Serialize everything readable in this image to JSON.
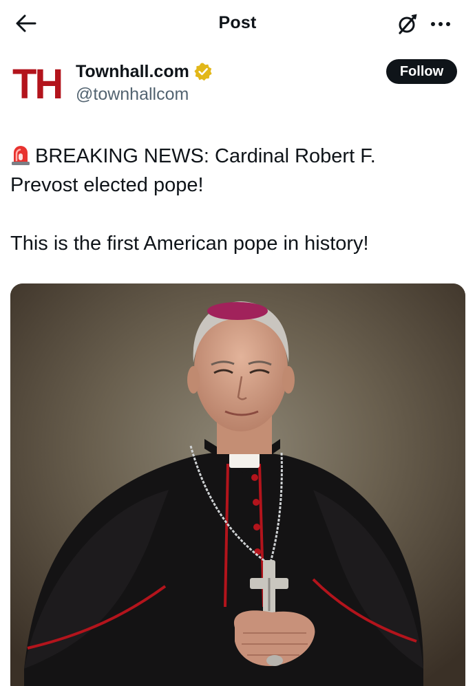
{
  "topbar": {
    "title": "Post",
    "back_icon": "arrow-left-icon",
    "grok_icon": "grok-icon",
    "more_icon": "more-dots-icon"
  },
  "author": {
    "avatar_text": "TH",
    "name": "Townhall.com",
    "handle": "@townhallcom",
    "verified": true,
    "verified_color": "#e2b719",
    "brand_color": "#b3141c"
  },
  "follow": {
    "label": "Follow"
  },
  "post": {
    "emoji": "police-light-icon",
    "line1": "BREAKING NEWS: Cardinal Robert F.",
    "line2": "Prevost elected pope!",
    "line3": "This is the first American pope in history!"
  },
  "media": {
    "type": "photo",
    "subject": "portrait-photo"
  }
}
